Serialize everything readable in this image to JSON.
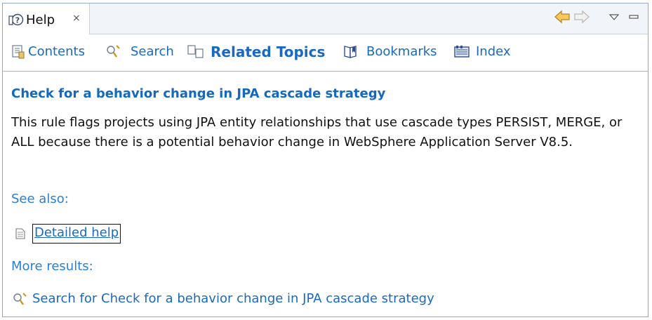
{
  "tab": {
    "title": "Help",
    "close_glyph": "×"
  },
  "tab_icons": {
    "help": "help-view-icon",
    "close": "close-icon"
  },
  "view_tools": [
    "back-arrow-icon",
    "forward-arrow-icon",
    "view-menu-icon",
    "minimize-icon"
  ],
  "toolbar": {
    "items": [
      {
        "label": "Contents",
        "icon": "contents-icon",
        "active": false
      },
      {
        "label": "Search",
        "icon": "search-icon",
        "active": false
      },
      {
        "label": "Related Topics",
        "icon": "related-topics-icon",
        "active": true
      },
      {
        "label": "Bookmarks",
        "icon": "bookmarks-icon",
        "active": false
      },
      {
        "label": "Index",
        "icon": "index-icon",
        "active": false
      }
    ]
  },
  "content": {
    "title": "Check for a behavior change in JPA cascade strategy",
    "description": "This rule flags projects using JPA entity relationships that use cascade types PERSIST, MERGE, or ALL because there is a potential behavior change in WebSphere Application Server V8.5.",
    "see_also_label": "See also:",
    "detailed_help_link": "Detailed help",
    "more_results_label": "More results:",
    "search_link": "Search for Check for a behavior change in JPA cascade strategy"
  },
  "colors": {
    "link": "#1a69c1",
    "title": "#1368c0",
    "border": "#97a8c8",
    "tab_bar": "#f1f4f9"
  }
}
